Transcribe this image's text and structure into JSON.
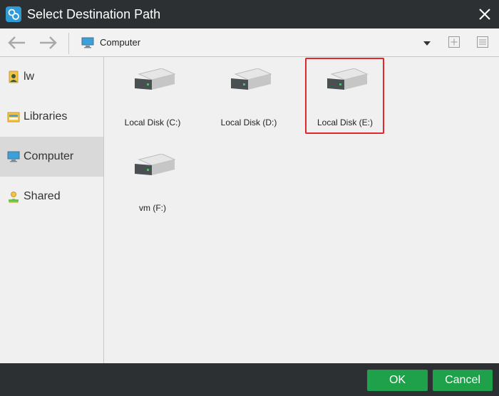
{
  "window": {
    "title": "Select Destination Path"
  },
  "icons": {
    "app": "app-logo-icon",
    "close": "close-icon",
    "back": "back-arrow-icon",
    "forward": "forward-arrow-icon",
    "computer": "computer-icon",
    "dropdown": "chevron-down-icon",
    "new_folder": "new-folder-icon",
    "view": "list-view-icon",
    "drive": "hard-drive-icon"
  },
  "toolbar": {
    "path": "Computer"
  },
  "sidebar": {
    "items": [
      {
        "label": "lw",
        "icon": "user-icon",
        "active": false
      },
      {
        "label": "Libraries",
        "icon": "libraries-icon",
        "active": false
      },
      {
        "label": "Computer",
        "icon": "computer-icon",
        "active": true
      },
      {
        "label": "Shared",
        "icon": "shared-icon",
        "active": false
      }
    ]
  },
  "drives": [
    {
      "label": "Local Disk (C:)",
      "selected": false
    },
    {
      "label": "Local Disk (D:)",
      "selected": false
    },
    {
      "label": "Local Disk (E:)",
      "selected": true
    },
    {
      "label": "vm (F:)",
      "selected": false
    }
  ],
  "buttons": {
    "ok": "OK",
    "cancel": "Cancel"
  },
  "colors": {
    "titlebar": "#2c3033",
    "accent_green": "#1fa04a",
    "selection_red": "#e0272a",
    "sidebar_active": "#d9d9d9"
  }
}
